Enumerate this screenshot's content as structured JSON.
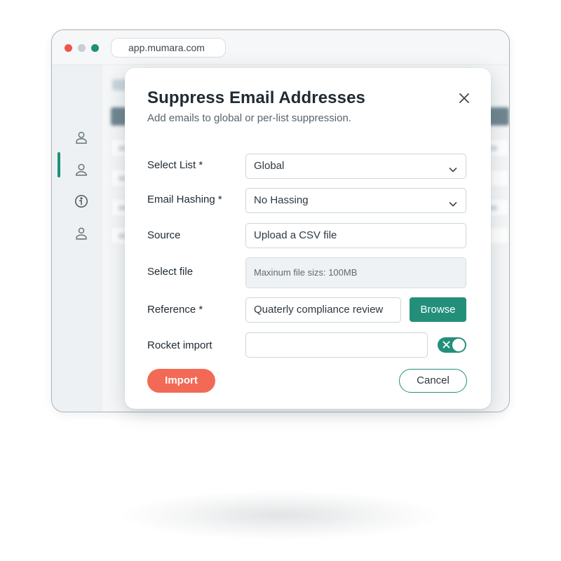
{
  "browser": {
    "url": "app.mumara.com"
  },
  "sidebar": {
    "items": [
      {
        "icon": "user-icon"
      },
      {
        "icon": "user-circle-icon"
      },
      {
        "icon": "info-shield-icon",
        "active": true
      },
      {
        "icon": "user-badge-icon"
      }
    ]
  },
  "modal": {
    "title": "Suppress Email Addresses",
    "subtitle": "Add emails to global or per-list suppression.",
    "fields": {
      "select_list": {
        "label": "Select List *",
        "value": "Global"
      },
      "email_hashing": {
        "label": "Email Hashing *",
        "value": "No Hassing"
      },
      "source": {
        "label": "Source",
        "value": "Upload a CSV file"
      },
      "select_file": {
        "label": "Select file",
        "placeholder": "Maxinum file sizs: 100MB"
      },
      "reference": {
        "label": "Reference *",
        "value": "Quaterly compliance review"
      },
      "rocket_import": {
        "label": "Rocket import",
        "value": "",
        "toggle_on": true
      }
    },
    "buttons": {
      "browse": "Browse",
      "import": "Import",
      "cancel": "Cancel"
    }
  },
  "colors": {
    "accent": "#238f7b",
    "import": "#f26a55",
    "close_dot": "#f0554b"
  }
}
